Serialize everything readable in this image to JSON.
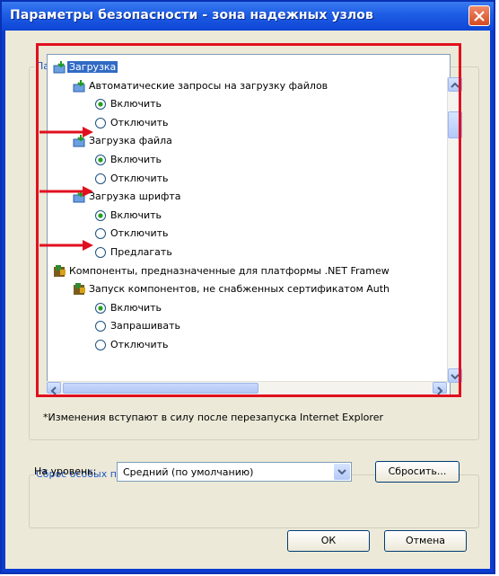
{
  "window": {
    "title": "Параметры безопасности - зона надежных узлов"
  },
  "settings_group": {
    "label": "Параметры"
  },
  "tree": {
    "items": [
      {
        "kind": "category",
        "label": "Загрузка",
        "selected": true
      },
      {
        "kind": "setting",
        "label": "Автоматические запросы на загрузку файлов"
      },
      {
        "kind": "radio",
        "label": "Включить",
        "checked": true
      },
      {
        "kind": "radio",
        "label": "Отключить",
        "checked": false
      },
      {
        "kind": "setting",
        "label": "Загрузка файла"
      },
      {
        "kind": "radio",
        "label": "Включить",
        "checked": true
      },
      {
        "kind": "radio",
        "label": "Отключить",
        "checked": false
      },
      {
        "kind": "setting",
        "label": "Загрузка шрифта"
      },
      {
        "kind": "radio",
        "label": "Включить",
        "checked": true
      },
      {
        "kind": "radio",
        "label": "Отключить",
        "checked": false
      },
      {
        "kind": "radio",
        "label": "Предлагать",
        "checked": false
      },
      {
        "kind": "category",
        "label": "Компоненты, предназначенные для платформы .NET Framew"
      },
      {
        "kind": "setting",
        "label": "Запуск компонентов, не снабженных сертификатом Auth"
      },
      {
        "kind": "radio",
        "label": "Включить",
        "checked": true
      },
      {
        "kind": "radio",
        "label": "Запрашивать",
        "checked": false
      },
      {
        "kind": "radio",
        "label": "Отключить",
        "checked": false
      }
    ]
  },
  "note": "*Изменения вступают в силу после перезапуска Internet Explorer",
  "reset_group": {
    "label": "Сброс особых параметров",
    "level_label": "На уровень:",
    "level_value": "Средний (по умолчанию)",
    "reset_button": "Сбросить..."
  },
  "buttons": {
    "ok": "ОК",
    "cancel": "Отмена"
  },
  "colors": {
    "title_bar": "#0d45d4",
    "highlight": "#e0101f",
    "selection": "#316ac5",
    "group_label": "#1e57c8"
  }
}
